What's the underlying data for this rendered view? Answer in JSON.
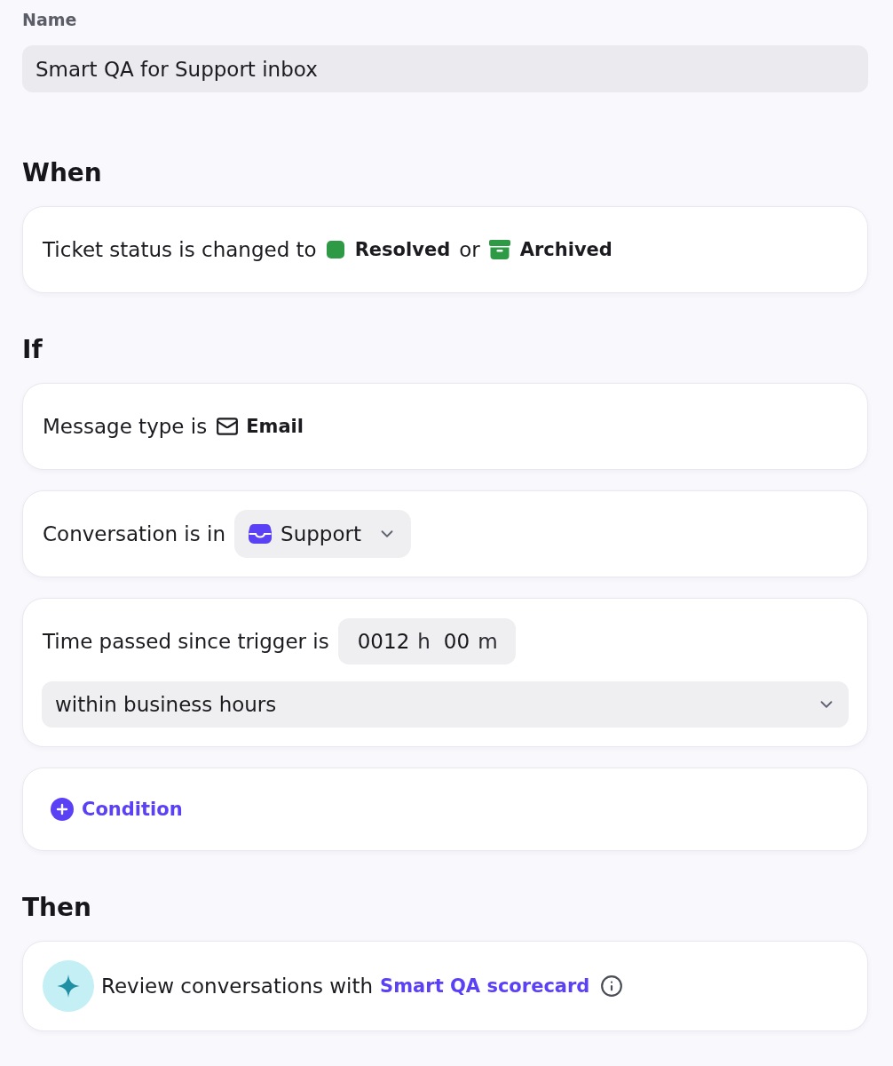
{
  "name_field": {
    "label": "Name",
    "value": "Smart QA for Support inbox"
  },
  "sections": [
    {
      "heading": "When",
      "cards": [
        {
          "kind": "rule",
          "parts": [
            {
              "kind": "text",
              "text": "Ticket status is changed to"
            },
            {
              "kind": "resolved",
              "text": "Resolved"
            },
            {
              "kind": "text",
              "text": "or"
            },
            {
              "kind": "archived",
              "text": "Archived"
            }
          ]
        }
      ]
    },
    {
      "heading": "If",
      "cards": [
        {
          "kind": "rule",
          "parts": [
            {
              "kind": "text",
              "text": "Message type is"
            },
            {
              "kind": "email",
              "text": "Email"
            }
          ]
        },
        {
          "kind": "rule",
          "parts": [
            {
              "kind": "text",
              "text": "Conversation is in"
            },
            {
              "kind": "inbox",
              "text": "Support"
            }
          ]
        },
        {
          "kind": "rule",
          "parts": [
            {
              "kind": "text",
              "text": "Time passed since trigger is"
            },
            {
              "kind": "duration",
              "hours": "0012",
              "hours_unit": "h",
              "minutes": "00",
              "minutes_unit": "m"
            }
          ],
          "select": {
            "value": "within business hours"
          }
        },
        {
          "kind": "add",
          "text": "Condition"
        }
      ]
    },
    {
      "heading": "Then",
      "cards": [
        {
          "kind": "action",
          "parts": [
            {
              "kind": "text",
              "text": "Review conversations with"
            },
            {
              "kind": "link",
              "text": "Smart QA scorecard"
            }
          ]
        }
      ]
    }
  ]
}
